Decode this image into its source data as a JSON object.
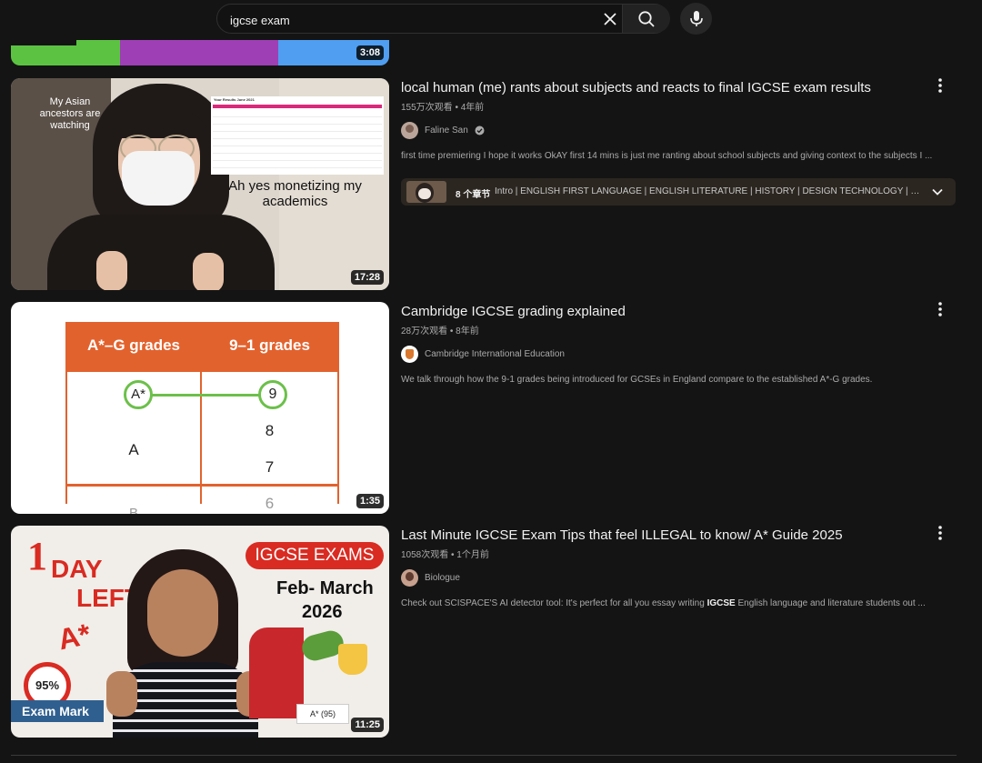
{
  "search": {
    "query": "igcse exam"
  },
  "top_partial": {
    "duration": "3:08"
  },
  "videos": [
    {
      "title": "local human (me) rants about subjects and reacts to final IGCSE exam results",
      "meta": "155万次观看 • 4年前",
      "channel": "Faline San",
      "verified": true,
      "description": "first time premiering I hope it works OkAY first 14 mins is just me ranting about school subjects and giving context to the subjects I ...",
      "duration": "17:28",
      "thumb_text": {
        "caption_left": "My Asian ancestors are watching",
        "caption_right": "Ah yes monetizing my academics",
        "sheet_title": "Your Results June 2021"
      },
      "chapters": {
        "count": "8 个章节",
        "list": "Intro | ENGLISH FIRST LANGUAGE | ENGLISH LITERATURE | HISTORY | DESIGN TECHNOLOGY | BUSINESS STUDIES ..."
      }
    },
    {
      "title": "Cambridge IGCSE grading explained",
      "meta": "28万次观看 • 8年前",
      "channel": "Cambridge International Education",
      "description": "We talk through how the 9-1 grades being introduced for GCSEs in England compare to the established A*-G grades.",
      "duration": "1:35",
      "thumb_text": {
        "col1": "A*–G grades",
        "col2": "9–1 grades",
        "a_star": "A*",
        "nine": "9",
        "a": "A",
        "eight": "8",
        "seven": "7",
        "six": "6",
        "b": "B"
      }
    },
    {
      "title": "Last Minute IGCSE Exam Tips that feel ILLEGAL to know/ A* Guide 2025",
      "meta": "1058次观看 • 1个月前",
      "channel": "Biologue",
      "description_pre": "Check out SCISPACE'S AI detector tool: It's perfect for all you essay writing ",
      "description_bold": "IGCSE",
      "description_post": " English language and literature students out ...",
      "duration": "11:25",
      "thumb_text": {
        "one": "1",
        "day": "DAY",
        "left": "LEFT",
        "banner": "IGCSE EXAMS",
        "months": "Feb- March",
        "year": "2026",
        "a_star": "A*",
        "percent": "95%",
        "exam_mark": "Exam Mark",
        "grade_card": "A* (95)"
      }
    }
  ],
  "icons": [
    "close-icon",
    "search-icon",
    "mic-icon",
    "more-vert-icon",
    "verified-icon",
    "chevron-down-icon"
  ],
  "colors": {
    "background": "#141414",
    "card_orange": "#e2622e",
    "green_ring": "#6cc04a",
    "chapters_bg": "#2b2620"
  }
}
